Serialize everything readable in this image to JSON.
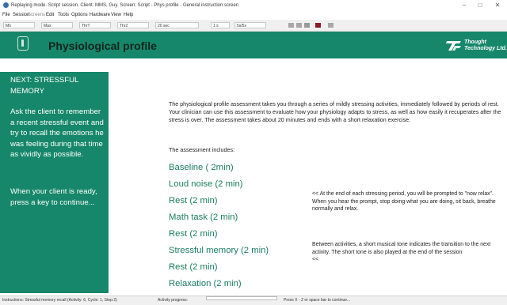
{
  "window": {
    "title": "Replaying mode. Script session. Client: MMS, Guy. Screen: Script - Phys profile - General instruction screen",
    "controls": {
      "minimize": "–",
      "maximize": "□",
      "close": "✕"
    }
  },
  "menu": {
    "items": [
      "File",
      "Session",
      "Screens",
      "Edit",
      "Tools",
      "Options",
      "Hardware",
      "View",
      "Help"
    ]
  },
  "toolbar": {
    "items": [
      "Mn",
      "Max",
      "ThrT",
      "Thr2",
      "20 sec",
      "1 s",
      "5s/5s"
    ],
    "swatch_colors": [
      "#a8a8a8",
      "#a8a8a8",
      "#9a9a9a",
      "#8a1c2a",
      "#a8a8a8"
    ]
  },
  "header": {
    "title": "Physiological profile",
    "logo_line1": "Thought",
    "logo_line2": "Technology Ltd.",
    "color": "#16876a"
  },
  "sidebar": {
    "heading": "NEXT: STRESSFUL MEMORY",
    "instruction": "Ask the client to remember a recent stressful event and try to recall the emotions he was feeling during that time as vividly as possible.",
    "prompt": "When your client is ready, press a key to continue..."
  },
  "main": {
    "intro": "The physiological profile assessment takes you through a series of mildly stressing activities, immediately followed by periods of rest. Your clinician can use this assessment to evaluate how your physiology adapts to stress, as well as how easily it recuperates after the stress is over. The assessment takes about 20 minutes and ends with a short relaxation exercise.",
    "includes_label": "The assessment includes:",
    "activities": [
      "Baseline ( 2min)",
      "Loud noise (2 min)",
      "Rest (2 min)",
      "Math task (2 min)",
      "Rest (2 min)",
      "Stressful memory (2 min)",
      "Rest (2 min)",
      "Relaxation (2 min)"
    ],
    "note_relax": "<< At the end of each stressing period, you will be prompted to \"now relax\". When you hear the prompt, stop doing what you are doing, sit back, breathe normally and relax.",
    "note_tone": "Between activities, a short musical tone indicates the transition to the next activity. The short tone is also played at the end of the session",
    "note_tone_suffix": "<<"
  },
  "status": {
    "instructions": "Instructions: Stressful memory recall (Activity: 6, Cycle: 1, Step:2)",
    "progress_label": "Activity progress:",
    "hint": "Press X - Z or space bar to continue..."
  },
  "colors": {
    "accent": "#16876a",
    "activity_text": "#1a7d5c"
  }
}
